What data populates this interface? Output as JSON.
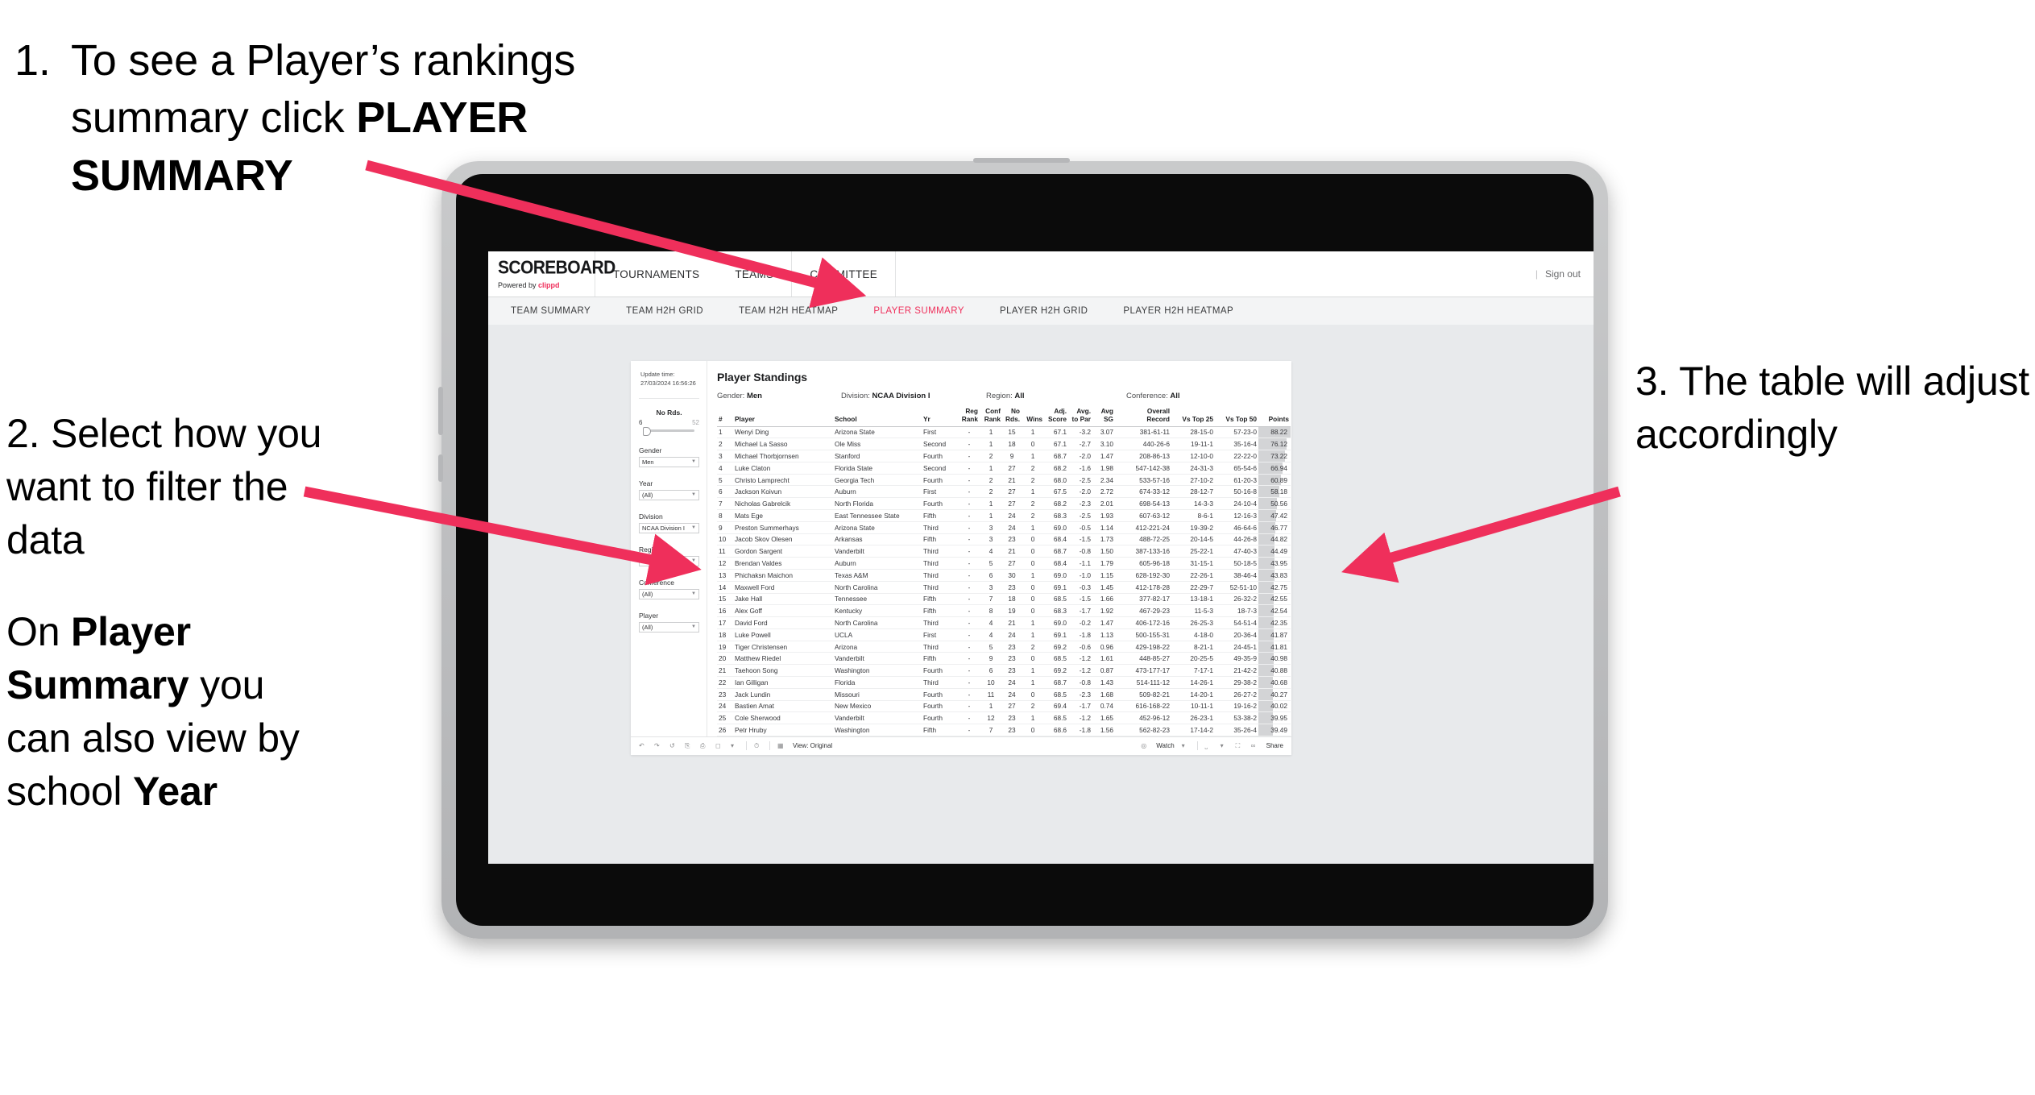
{
  "annotations": {
    "step1": {
      "number": "1.",
      "text_before": "To see a Player’s rankings summary click ",
      "bold": "PLAYER SUMMARY"
    },
    "step2": {
      "para1": "2. Select how you want to filter the data",
      "para2_a": "On ",
      "para2_b": "Player Summary",
      "para2_c": " you can also view by school ",
      "para2_d": "Year"
    },
    "step3": {
      "text": "3. The table will adjust accordingly"
    },
    "arrow_color": "#ef2f5b"
  },
  "app": {
    "logo": {
      "main": "SCOREBOARD",
      "sub_prefix": "Powered by ",
      "sub_brand": "clippd"
    },
    "topnav": [
      "TOURNAMENTS",
      "TEAMS",
      "COMMITTEE"
    ],
    "account": {
      "divider": "|",
      "sign_out": "Sign out"
    },
    "subtabs": [
      {
        "label": "TEAM SUMMARY",
        "active": false
      },
      {
        "label": "TEAM H2H GRID",
        "active": false
      },
      {
        "label": "TEAM H2H HEATMAP",
        "active": false
      },
      {
        "label": "PLAYER SUMMARY",
        "active": true
      },
      {
        "label": "PLAYER H2H GRID",
        "active": false
      },
      {
        "label": "PLAYER H2H HEATMAP",
        "active": false
      }
    ]
  },
  "sheet": {
    "update_label": "Update time:",
    "update_value": "27/03/2024 16:56:26",
    "title": "Player Standings",
    "filter_summary": [
      {
        "label": "Gender: ",
        "value": "Men"
      },
      {
        "label": "Division: ",
        "value": "NCAA Division I"
      },
      {
        "label": "Region: ",
        "value": "All"
      },
      {
        "label": "Conference: ",
        "value": "All"
      }
    ],
    "slider": {
      "title": "No Rds.",
      "min": "6",
      "max": "52"
    },
    "filters": [
      {
        "label": "Gender",
        "value": "Men"
      },
      {
        "label": "Year",
        "value": "(All)"
      },
      {
        "label": "Division",
        "value": "NCAA Division I"
      },
      {
        "label": "Region",
        "value": "N/A"
      },
      {
        "label": "Conference",
        "value": "(All)"
      },
      {
        "label": "Player",
        "value": "(All)"
      }
    ],
    "toolbar": {
      "view_label": "View: Original",
      "watch_label": "Watch",
      "share_label": "Share"
    }
  },
  "chart_data": {
    "type": "table",
    "title": "Player Standings",
    "columns": [
      "#",
      "Player",
      "School",
      "Yr",
      "Reg Rank",
      "Conf Rank",
      "No Rds.",
      "Wins",
      "Adj. Score",
      "Avg. to Par",
      "Avg SG",
      "Overall Record",
      "Vs Top 25",
      "Vs Top 50",
      "Points"
    ],
    "column_headers_wrapped": [
      {
        "l1": "#",
        "l2": ""
      },
      {
        "l1": "Player",
        "l2": ""
      },
      {
        "l1": "School",
        "l2": ""
      },
      {
        "l1": "Yr",
        "l2": ""
      },
      {
        "l1": "Reg",
        "l2": "Rank"
      },
      {
        "l1": "Conf",
        "l2": "Rank"
      },
      {
        "l1": "No",
        "l2": "Rds."
      },
      {
        "l1": "Wins",
        "l2": ""
      },
      {
        "l1": "Adj.",
        "l2": "Score"
      },
      {
        "l1": "Avg.",
        "l2": "to Par"
      },
      {
        "l1": "Avg",
        "l2": "SG"
      },
      {
        "l1": "Overall",
        "l2": "Record"
      },
      {
        "l1": "Vs Top 25",
        "l2": ""
      },
      {
        "l1": "Vs Top 50",
        "l2": ""
      },
      {
        "l1": "Points",
        "l2": ""
      }
    ],
    "points_max": 88.22,
    "rows": [
      [
        "1",
        "Wenyi Ding",
        "Arizona State",
        "First",
        "-",
        "1",
        "15",
        "1",
        "67.1",
        "-3.2",
        "3.07",
        "381-61-11",
        "28-15-0",
        "57-23-0",
        "88.22"
      ],
      [
        "2",
        "Michael La Sasso",
        "Ole Miss",
        "Second",
        "-",
        "1",
        "18",
        "0",
        "67.1",
        "-2.7",
        "3.10",
        "440-26-6",
        "19-11-1",
        "35-16-4",
        "76.12"
      ],
      [
        "3",
        "Michael Thorbjornsen",
        "Stanford",
        "Fourth",
        "-",
        "2",
        "9",
        "1",
        "68.7",
        "-2.0",
        "1.47",
        "208-86-13",
        "12-10-0",
        "22-22-0",
        "73.22"
      ],
      [
        "4",
        "Luke Claton",
        "Florida State",
        "Second",
        "-",
        "1",
        "27",
        "2",
        "68.2",
        "-1.6",
        "1.98",
        "547-142-38",
        "24-31-3",
        "65-54-6",
        "66.94"
      ],
      [
        "5",
        "Christo Lamprecht",
        "Georgia Tech",
        "Fourth",
        "-",
        "2",
        "21",
        "2",
        "68.0",
        "-2.5",
        "2.34",
        "533-57-16",
        "27-10-2",
        "61-20-3",
        "60.89"
      ],
      [
        "6",
        "Jackson Koivun",
        "Auburn",
        "First",
        "-",
        "2",
        "27",
        "1",
        "67.5",
        "-2.0",
        "2.72",
        "674-33-12",
        "28-12-7",
        "50-16-8",
        "58.18"
      ],
      [
        "7",
        "Nicholas Gabrelcik",
        "North Florida",
        "Fourth",
        "-",
        "1",
        "27",
        "2",
        "68.2",
        "-2.3",
        "2.01",
        "698-54-13",
        "14-3-3",
        "24-10-4",
        "50.56"
      ],
      [
        "8",
        "Mats Ege",
        "East Tennessee State",
        "Fifth",
        "-",
        "1",
        "24",
        "2",
        "68.3",
        "-2.5",
        "1.93",
        "607-63-12",
        "8-6-1",
        "12-16-3",
        "47.42"
      ],
      [
        "9",
        "Preston Summerhays",
        "Arizona State",
        "Third",
        "-",
        "3",
        "24",
        "1",
        "69.0",
        "-0.5",
        "1.14",
        "412-221-24",
        "19-39-2",
        "46-64-6",
        "46.77"
      ],
      [
        "10",
        "Jacob Skov Olesen",
        "Arkansas",
        "Fifth",
        "-",
        "3",
        "23",
        "0",
        "68.4",
        "-1.5",
        "1.73",
        "488-72-25",
        "20-14-5",
        "44-26-8",
        "44.82"
      ],
      [
        "11",
        "Gordon Sargent",
        "Vanderbilt",
        "Third",
        "-",
        "4",
        "21",
        "0",
        "68.7",
        "-0.8",
        "1.50",
        "387-133-16",
        "25-22-1",
        "47-40-3",
        "44.49"
      ],
      [
        "12",
        "Brendan Valdes",
        "Auburn",
        "Third",
        "-",
        "5",
        "27",
        "0",
        "68.4",
        "-1.1",
        "1.79",
        "605-96-18",
        "31-15-1",
        "50-18-5",
        "43.95"
      ],
      [
        "13",
        "Phichaksn Maichon",
        "Texas A&M",
        "Third",
        "-",
        "6",
        "30",
        "1",
        "69.0",
        "-1.0",
        "1.15",
        "628-192-30",
        "22-26-1",
        "38-46-4",
        "43.83"
      ],
      [
        "14",
        "Maxwell Ford",
        "North Carolina",
        "Third",
        "-",
        "3",
        "23",
        "0",
        "69.1",
        "-0.3",
        "1.45",
        "412-178-28",
        "22-29-7",
        "52-51-10",
        "42.75"
      ],
      [
        "15",
        "Jake Hall",
        "Tennessee",
        "Fifth",
        "-",
        "7",
        "18",
        "0",
        "68.5",
        "-1.5",
        "1.66",
        "377-82-17",
        "13-18-1",
        "26-32-2",
        "42.55"
      ],
      [
        "16",
        "Alex Goff",
        "Kentucky",
        "Fifth",
        "-",
        "8",
        "19",
        "0",
        "68.3",
        "-1.7",
        "1.92",
        "467-29-23",
        "11-5-3",
        "18-7-3",
        "42.54"
      ],
      [
        "17",
        "David Ford",
        "North Carolina",
        "Third",
        "-",
        "4",
        "21",
        "1",
        "69.0",
        "-0.2",
        "1.47",
        "406-172-16",
        "26-25-3",
        "54-51-4",
        "42.35"
      ],
      [
        "18",
        "Luke Powell",
        "UCLA",
        "First",
        "-",
        "4",
        "24",
        "1",
        "69.1",
        "-1.8",
        "1.13",
        "500-155-31",
        "4-18-0",
        "20-36-4",
        "41.87"
      ],
      [
        "19",
        "Tiger Christensen",
        "Arizona",
        "Third",
        "-",
        "5",
        "23",
        "2",
        "69.2",
        "-0.6",
        "0.96",
        "429-198-22",
        "8-21-1",
        "24-45-1",
        "41.81"
      ],
      [
        "20",
        "Matthew Riedel",
        "Vanderbilt",
        "Fifth",
        "-",
        "9",
        "23",
        "0",
        "68.5",
        "-1.2",
        "1.61",
        "448-85-27",
        "20-25-5",
        "49-35-9",
        "40.98"
      ],
      [
        "21",
        "Taehoon Song",
        "Washington",
        "Fourth",
        "-",
        "6",
        "23",
        "1",
        "69.2",
        "-1.2",
        "0.87",
        "473-177-17",
        "7-17-1",
        "21-42-2",
        "40.88"
      ],
      [
        "22",
        "Ian Gilligan",
        "Florida",
        "Third",
        "-",
        "10",
        "24",
        "1",
        "68.7",
        "-0.8",
        "1.43",
        "514-111-12",
        "14-26-1",
        "29-38-2",
        "40.68"
      ],
      [
        "23",
        "Jack Lundin",
        "Missouri",
        "Fourth",
        "-",
        "11",
        "24",
        "0",
        "68.5",
        "-2.3",
        "1.68",
        "509-82-21",
        "14-20-1",
        "26-27-2",
        "40.27"
      ],
      [
        "24",
        "Bastien Amat",
        "New Mexico",
        "Fourth",
        "-",
        "1",
        "27",
        "2",
        "69.4",
        "-1.7",
        "0.74",
        "616-168-22",
        "10-11-1",
        "19-16-2",
        "40.02"
      ],
      [
        "25",
        "Cole Sherwood",
        "Vanderbilt",
        "Fourth",
        "-",
        "12",
        "23",
        "1",
        "68.5",
        "-1.2",
        "1.65",
        "452-96-12",
        "26-23-1",
        "53-38-2",
        "39.95"
      ],
      [
        "26",
        "Petr Hruby",
        "Washington",
        "Fifth",
        "-",
        "7",
        "23",
        "0",
        "68.6",
        "-1.8",
        "1.56",
        "562-82-23",
        "17-14-2",
        "35-26-4",
        "39.49"
      ]
    ]
  }
}
